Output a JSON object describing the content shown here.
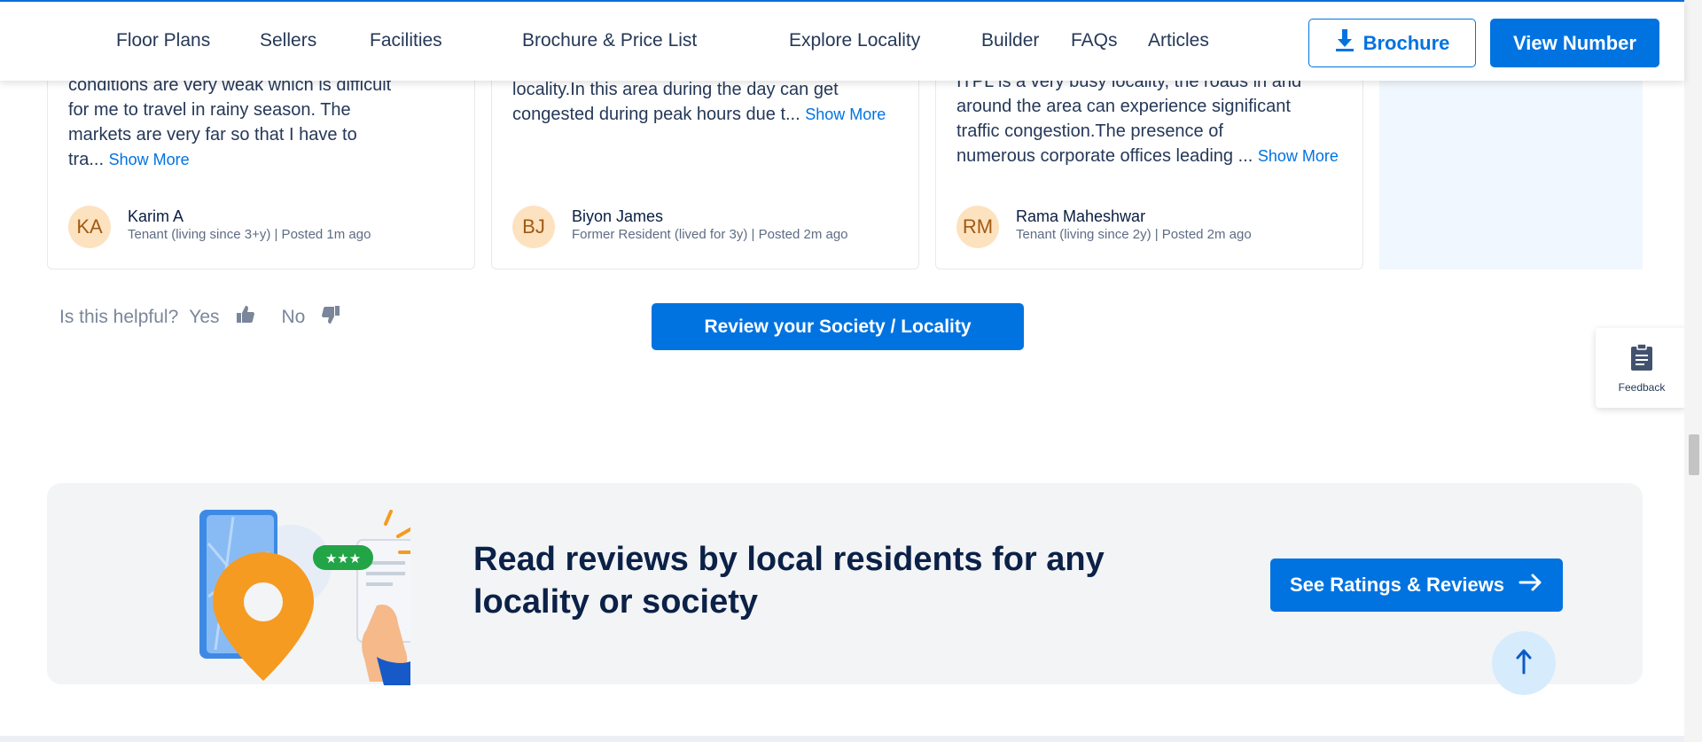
{
  "nav": {
    "links": [
      "Floor Plans",
      "Sellers",
      "Facilities",
      "Brochure & Price List",
      "Explore Locality",
      "Builder",
      "FAQs",
      "Articles"
    ],
    "brochure_label": "Brochure",
    "view_number_label": "View Number"
  },
  "reviews": [
    {
      "lines": [
        "conditions are very weak which is difficult",
        "for me to travel in rainy season. The",
        "markets are very far so that I have to",
        "tra..."
      ],
      "show_more": "Show More",
      "initials": "KA",
      "author": "Karim A",
      "meta": "Tenant (living since 3+y) | Posted 1m ago"
    },
    {
      "lines": [
        "locality.In this area during the day can get",
        "congested during peak hours due t..."
      ],
      "show_more": "Show More",
      "initials": "BJ",
      "author": "Biyon James",
      "meta": "Former Resident (lived for 3y) | Posted 2m ago"
    },
    {
      "lines": [
        "ITPL is a very busy locality, the roads in and",
        "around the area can experience significant",
        "traffic congestion.The presence of",
        "numerous corporate offices leading ..."
      ],
      "show_more": "Show More",
      "initials": "RM",
      "author": "Rama Maheshwar",
      "meta": "Tenant (living since 2y) | Posted 2m ago"
    }
  ],
  "helpful": {
    "question": "Is this helpful?",
    "yes": "Yes",
    "no": "No"
  },
  "review_button_label": "Review your Society / Locality",
  "feedback_label": "Feedback",
  "banner": {
    "title": "Read reviews by local residents for any locality or society",
    "button_label": "See Ratings & Reviews",
    "stars": "★★★"
  },
  "colors": {
    "primary": "#0073e1",
    "heading": "#0b2147",
    "banner_bg": "#f3f4f6",
    "avatar_bg": "#fde2c0"
  },
  "icons": [
    "download-icon",
    "thumbs-up-icon",
    "thumbs-down-icon",
    "clipboard-icon",
    "arrow-right-icon",
    "arrow-up-icon"
  ]
}
